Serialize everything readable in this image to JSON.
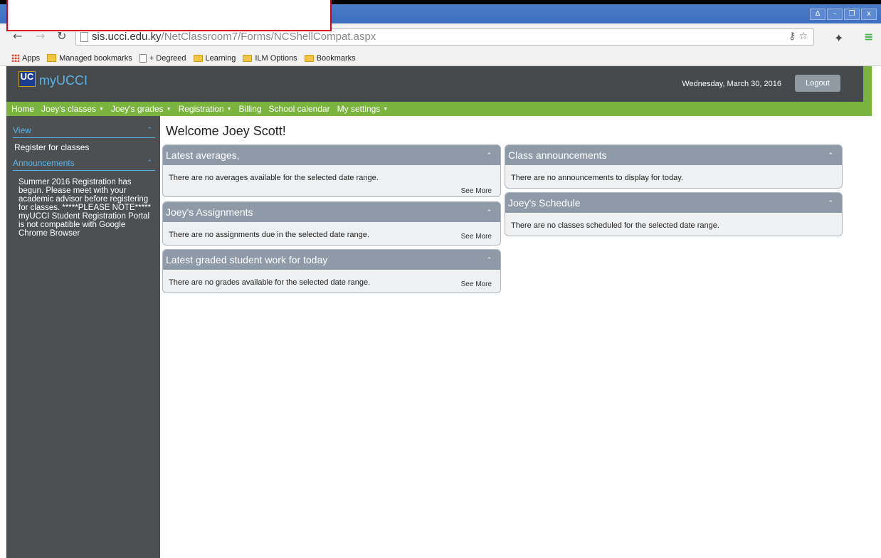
{
  "browser": {
    "url_host": "sis.ucci.edu.ky",
    "url_path": "/NetClassroom7/Forms/NCShellCompat.aspx",
    "window_buttons": [
      "Δ",
      "–",
      "❐",
      "x"
    ],
    "bookmarks": [
      {
        "label": "Apps",
        "icon": "apps-grid-icon"
      },
      {
        "label": "Managed bookmarks",
        "icon": "managed-folder-icon"
      },
      {
        "label": "+ Degreed",
        "icon": "page-icon"
      },
      {
        "label": "Learning",
        "icon": "folder-icon"
      },
      {
        "label": "ILM Options",
        "icon": "folder-icon"
      },
      {
        "label": "Bookmarks",
        "icon": "folder-icon"
      }
    ]
  },
  "header": {
    "logo_text": "UC",
    "brand": "myUCCI",
    "date": "Wednesday, March 30, 2016",
    "logout": "Logout"
  },
  "menu": [
    {
      "label": "Home",
      "dropdown": false
    },
    {
      "label": "Joey's classes",
      "dropdown": true
    },
    {
      "label": "Joey's grades",
      "dropdown": true
    },
    {
      "label": "Registration",
      "dropdown": true
    },
    {
      "label": "Billing",
      "dropdown": false
    },
    {
      "label": "School calendar",
      "dropdown": false
    },
    {
      "label": "My settings",
      "dropdown": true
    }
  ],
  "sidebar": {
    "view_heading": "View",
    "register_link": "Register for classes",
    "announcements_heading": "Announcements",
    "announcement_text": "Summer 2016 Registration has begun. Please meet with your academic advisor before registering for classes. *****PLEASE NOTE***** myUCCI Student Registration Portal is not compatible with Google Chrome Browser"
  },
  "main": {
    "welcome": "Welcome Joey Scott!",
    "see_more": "See More",
    "widgets": {
      "averages": {
        "title": "Latest averages,",
        "message": "There are no averages available for the selected date range."
      },
      "assignments": {
        "title": "Joey's Assignments",
        "message": "There are no assignments due in the selected date range."
      },
      "graded": {
        "title": "Latest graded student work for today",
        "message": "There are no grades available for the selected date range."
      },
      "announcements": {
        "title": "Class announcements",
        "message": "There are no announcements to display for today."
      },
      "schedule": {
        "title": "Joey's Schedule",
        "message": "There are no classes scheduled for the selected date range."
      }
    }
  },
  "colors": {
    "header_bg": "#45494c",
    "menu_green": "#7ab33d",
    "sidebar_bg": "#4d5053",
    "link_blue": "#5ab4e8",
    "widget_head": "#8f9aa8"
  }
}
